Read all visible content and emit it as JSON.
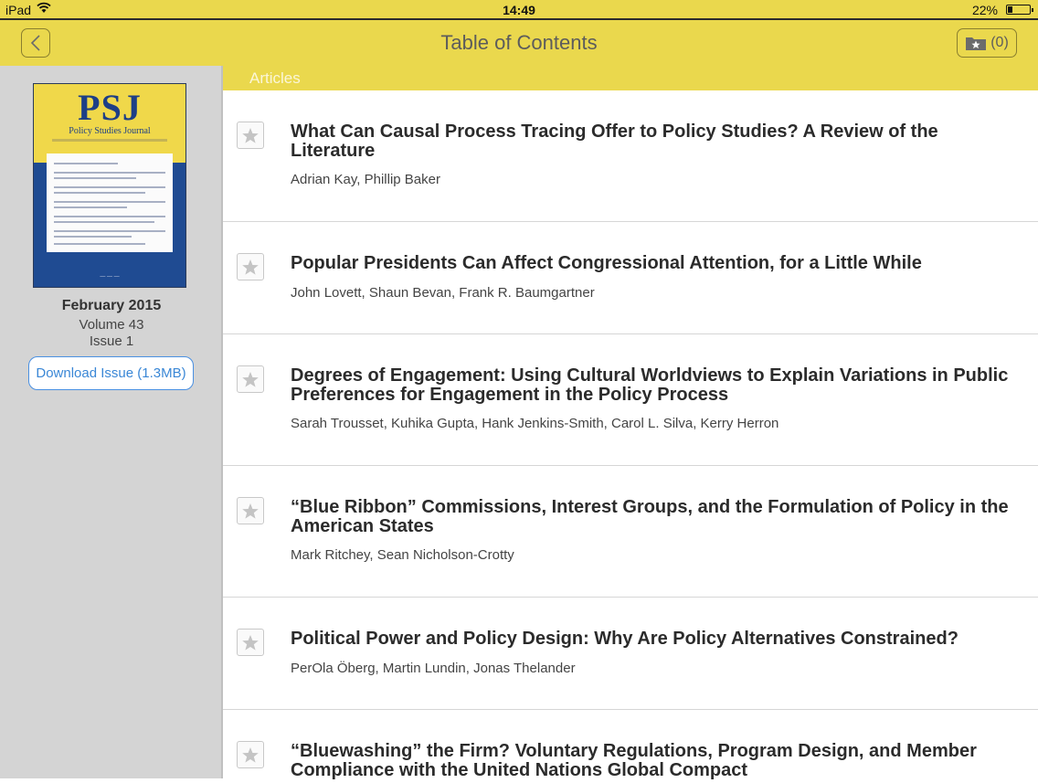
{
  "status_bar": {
    "carrier": "iPad",
    "time": "14:49",
    "battery_percent": "22%",
    "battery_level": 0.22
  },
  "nav": {
    "title": "Table of Contents",
    "favorites_count": "(0)",
    "back_icon": "chevron-left-icon",
    "favorites_icon": "folder-star-icon"
  },
  "issue": {
    "cover_title": "PSJ",
    "cover_subtitle": "Policy Studies Journal",
    "date": "February 2015",
    "volume": "Volume 43",
    "number": "Issue 1",
    "download_label": "Download Issue (1.3MB)"
  },
  "section": {
    "label": "Articles"
  },
  "articles": [
    {
      "title": "What Can Causal Process Tracing Offer to Policy Studies? A Review of the Literature",
      "authors": "Adrian Kay, Phillip Baker"
    },
    {
      "title": "Popular Presidents Can Affect Congressional Attention, for a Little While",
      "authors": "John Lovett, Shaun Bevan, Frank R. Baumgartner"
    },
    {
      "title": "Degrees of Engagement: Using Cultural Worldviews to Explain Variations in Public Preferences for Engagement in the Policy Process",
      "authors": "Sarah Trousset, Kuhika Gupta, Hank Jenkins-Smith, Carol L. Silva, Kerry Herron"
    },
    {
      "title": "“Blue Ribbon” Commissions, Interest Groups, and the Formulation of Policy in the American States",
      "authors": "Mark Ritchey, Sean Nicholson-Crotty"
    },
    {
      "title": "Political Power and Policy Design: Why Are Policy Alternatives Constrained?",
      "authors": "PerOla Öberg, Martin Lundin, Jonas Thelander"
    },
    {
      "title": "“Bluewashing” the Firm? Voluntary Regulations, Program Design, and Member Compliance with the United Nations Global Compact",
      "authors": ""
    }
  ],
  "colors": {
    "bar_yellow": "#ead84d",
    "sidebar_gray": "#d4d4d4",
    "link_blue": "#3a87d6"
  }
}
